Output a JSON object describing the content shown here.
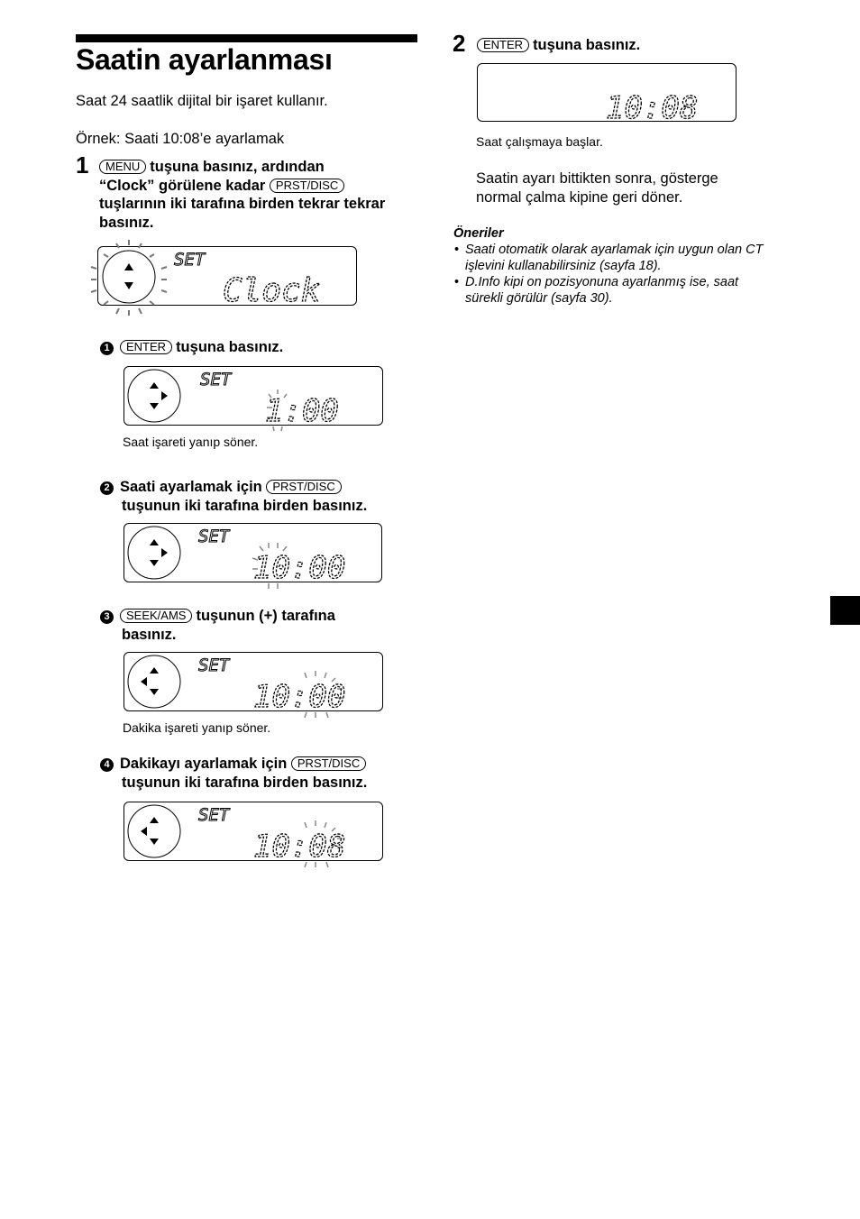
{
  "page": {
    "title": "Saatin ayarlanması",
    "intro": "Saat 24 saatlik dijital bir işaret kullanır.",
    "example": "Örnek: Saati 10:08’e ayarlamak"
  },
  "step1": {
    "number": "1",
    "key1": "MENU",
    "text_a": "tuşuna basınız, ardından",
    "text_b": "“Clock” görülene kadar",
    "key2": "PRST/DISC",
    "text_c": "tuşlarının iki tarafına birden tekrar tekrar",
    "text_d": "basınız.",
    "display": {
      "label": "SET",
      "value": "Clock"
    },
    "substeps": [
      {
        "marker": "1",
        "key": "ENTER",
        "text_a": "tuşuna basınız.",
        "text_b": "",
        "display": {
          "label": "SET",
          "value": "1:00"
        },
        "caption": "Saat işareti yanıp söner."
      },
      {
        "marker": "2",
        "key": "PRST/DISC",
        "text_a": "Saati ayarlamak için",
        "text_b": "tuşunun iki tarafına birden basınız.",
        "display": {
          "label": "SET",
          "value": "10:00"
        },
        "caption": ""
      },
      {
        "marker": "3",
        "key": "SEEK/AMS",
        "text_a": "tuşunun (+) tarafına",
        "text_b": "basınız.",
        "display": {
          "label": "SET",
          "value": "10:00"
        },
        "caption": "Dakika işareti yanıp söner."
      },
      {
        "marker": "4",
        "key": "PRST/DISC",
        "text_a": "Dakikayı ayarlamak için",
        "text_b": "tuşunun iki tarafına birden basınız.",
        "display": {
          "label": "SET",
          "value": "10:08"
        },
        "caption": ""
      }
    ]
  },
  "step2": {
    "number": "2",
    "key": "ENTER",
    "text": "tuşuna basınız.",
    "display": {
      "value": "10:08"
    },
    "caption": "Saat çalışmaya başlar.",
    "note_line1": "Saatin ayarı bittikten sonra, gösterge",
    "note_line2": "normal çalma kipine geri döner."
  },
  "tips": {
    "heading": "Öneriler",
    "items": [
      {
        "line1": "Saati otomatik olarak ayarlamak için uygun olan CT",
        "line2": "işlevini kullanabilirsiniz (sayfa 18)."
      },
      {
        "line1": "D.Info kipi on pozisyonuna ayarlanmış ise, saat",
        "line2": "sürekli görülür (sayfa 30)."
      }
    ]
  }
}
